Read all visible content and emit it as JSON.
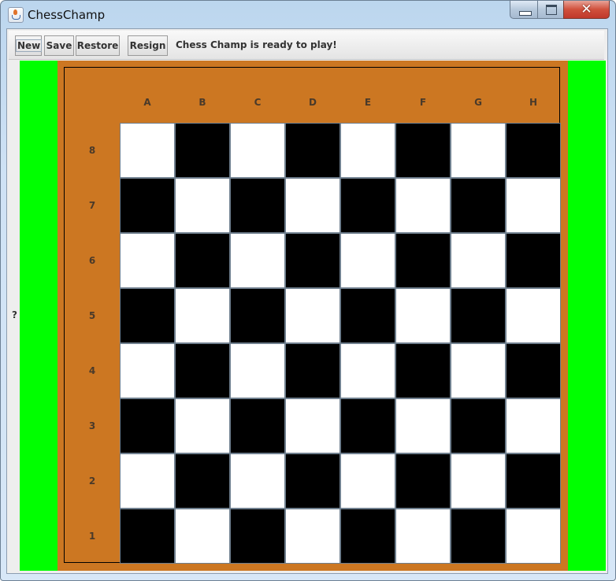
{
  "window": {
    "title": "ChessChamp",
    "controls": {
      "minimize": "minimize",
      "maximize": "maximize",
      "close": "✕"
    }
  },
  "toolbar": {
    "buttons": [
      {
        "id": "new",
        "label": "New"
      },
      {
        "id": "save",
        "label": "Save"
      },
      {
        "id": "restore",
        "label": "Restore"
      },
      {
        "id": "resign",
        "label": "Resign"
      }
    ],
    "status": "Chess Champ is ready to play!"
  },
  "side_label": "?",
  "board": {
    "files": [
      "A",
      "B",
      "C",
      "D",
      "E",
      "F",
      "G",
      "H"
    ],
    "ranks": [
      "8",
      "7",
      "6",
      "5",
      "4",
      "3",
      "2",
      "1"
    ],
    "pieces": [],
    "colors": {
      "light_square": "#ffffff",
      "dark_square": "#000000",
      "border": "#cc7722",
      "side_panels": "#00ff00",
      "square_outline": "#6f7f8e"
    }
  }
}
